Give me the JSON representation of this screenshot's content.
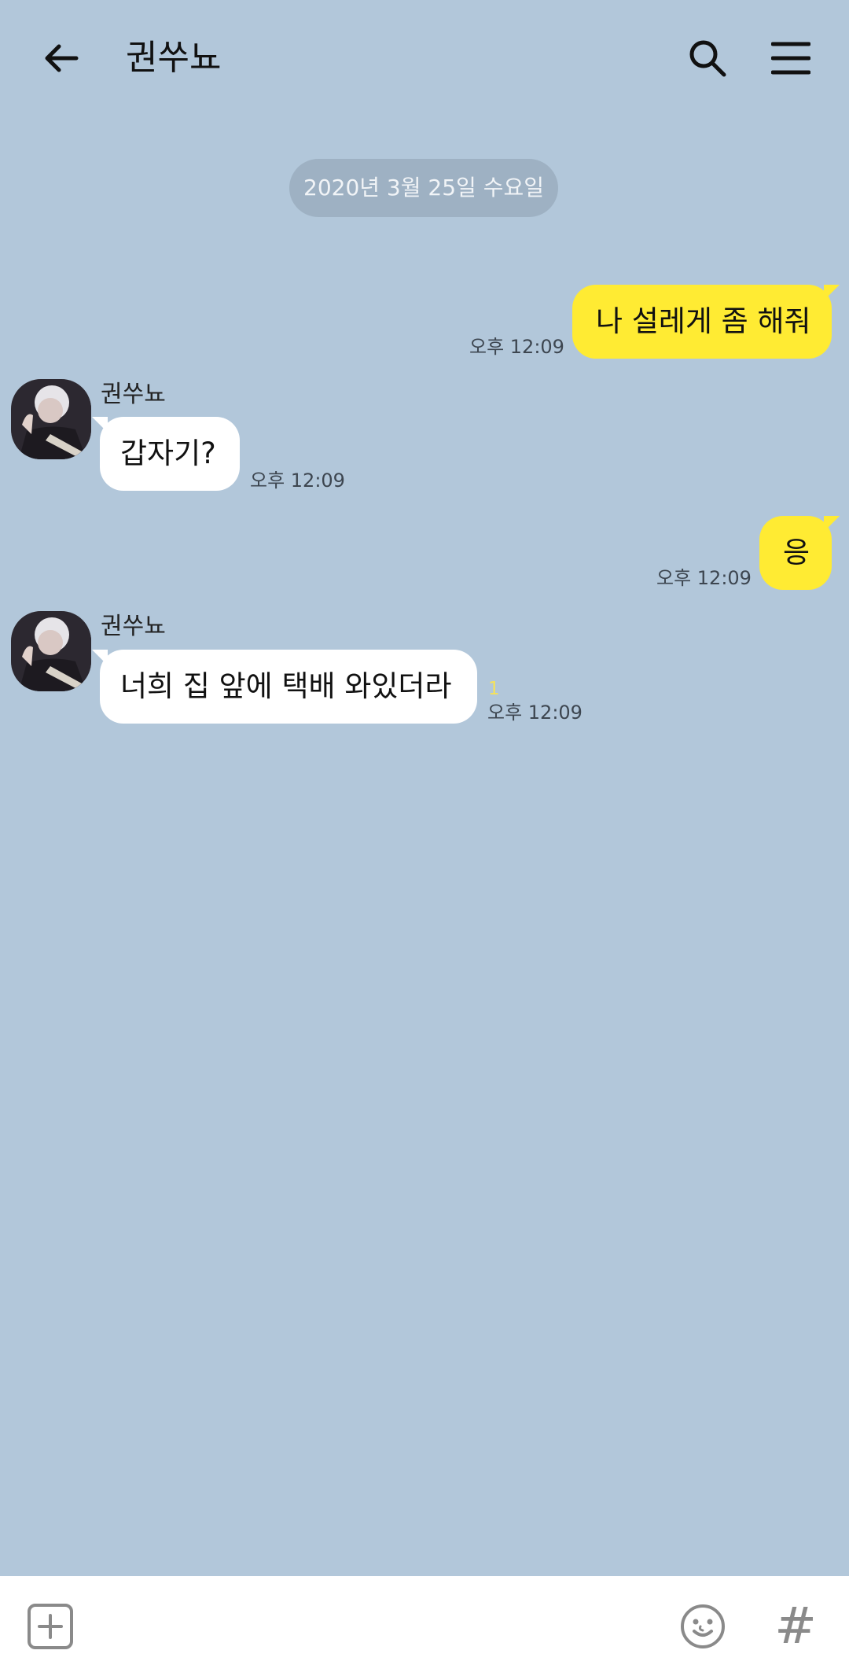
{
  "header": {
    "title": "권쑤뇨",
    "back_icon": "arrow-left-icon",
    "search_icon": "search-icon",
    "menu_icon": "hamburger-menu-icon"
  },
  "date_divider": "2020년 3월 25일 수요일",
  "messages": [
    {
      "from": "me",
      "text": "나 설레게 좀 해줘",
      "time": "오후 12:09"
    },
    {
      "from": "them",
      "sender": "권쑤뇨",
      "text": "갑자기?",
      "time": "오후 12:09"
    },
    {
      "from": "me",
      "text": "응",
      "time": "오후 12:09"
    },
    {
      "from": "them",
      "sender": "권쑤뇨",
      "text": "너희 집 앞에 택배 와있더라",
      "time": "오후 12:09",
      "unread": "1"
    }
  ],
  "input_bar": {
    "plus_icon": "plus-square-icon",
    "emoji_icon": "emoji-smile-icon",
    "hash_label": "#"
  },
  "colors": {
    "background": "#b2c7da",
    "my_bubble": "#ffeb33",
    "their_bubble": "#ffffff",
    "unread": "#f6e25a"
  }
}
